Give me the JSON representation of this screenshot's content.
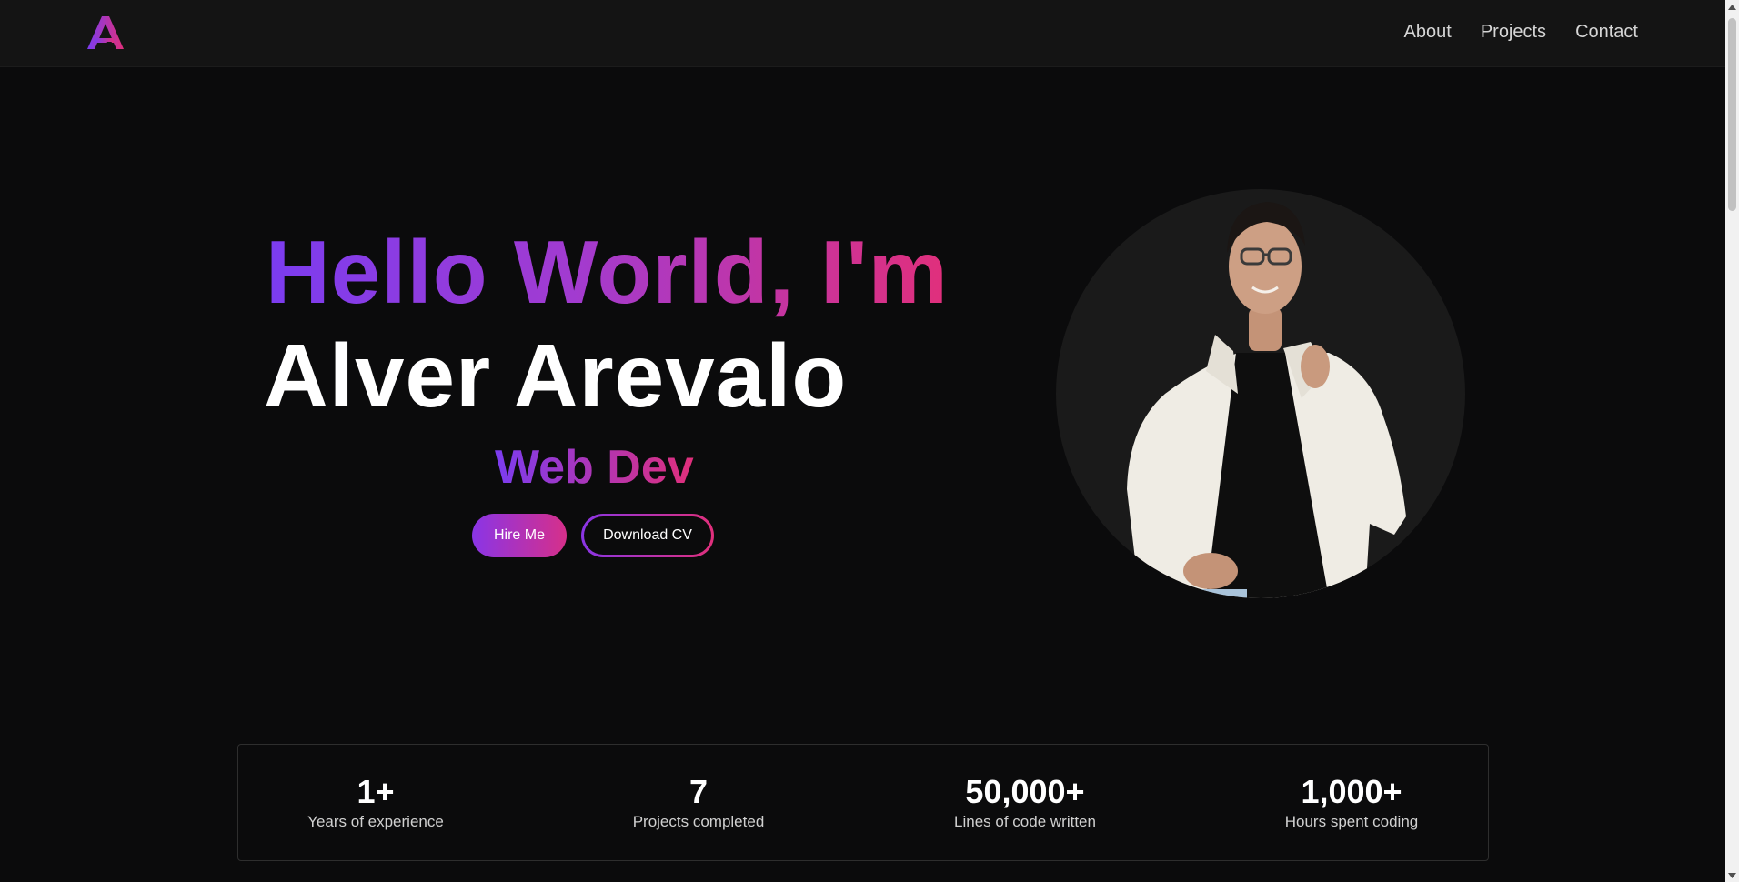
{
  "brand": {
    "logo_icon": "a-monogram-icon",
    "colors": {
      "purple": "#7b3cf0",
      "pink": "#e12f7b"
    }
  },
  "nav": {
    "links": [
      {
        "label": "About"
      },
      {
        "label": "Projects"
      },
      {
        "label": "Contact"
      }
    ]
  },
  "hero": {
    "greeting": "Hello World, I'm",
    "name": "Alver Arevalo",
    "role": "Web Dev",
    "hire_label": "Hire Me",
    "download_label": "Download CV"
  },
  "stats": [
    {
      "value": "1+",
      "label": "Years of experience"
    },
    {
      "value": "7",
      "label": "Projects completed"
    },
    {
      "value": "50,000+",
      "label": "Lines of code written"
    },
    {
      "value": "1,000+",
      "label": "Hours spent coding"
    }
  ]
}
